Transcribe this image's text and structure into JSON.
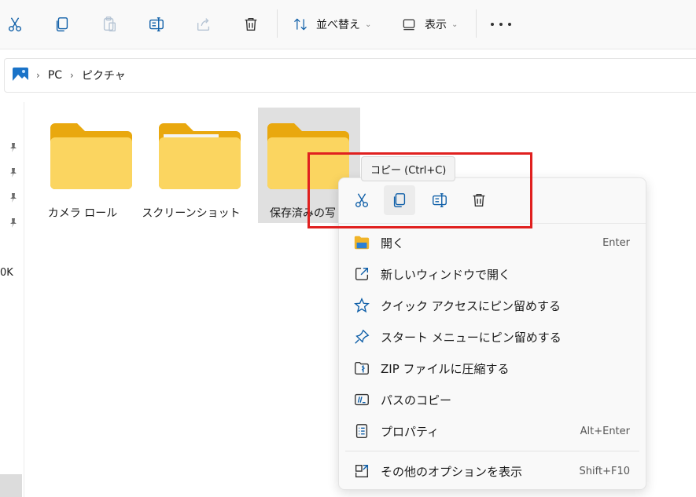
{
  "toolbar": {
    "sort_label": "並べ替え",
    "view_label": "表示"
  },
  "breadcrumb": [
    "PC",
    "ピクチャ"
  ],
  "sidebar": {
    "partial_text": "0K"
  },
  "folders": [
    {
      "name": "カメラ ロール"
    },
    {
      "name": "スクリーンショット"
    },
    {
      "name": "保存済みの写"
    }
  ],
  "tooltip": {
    "text": "コピー (Ctrl+C)"
  },
  "context_menu": {
    "items": [
      {
        "label": "開く",
        "shortcut": "Enter",
        "icon": "folder-open-icon"
      },
      {
        "label": "新しいウィンドウで開く",
        "shortcut": "",
        "icon": "open-new-window-icon"
      },
      {
        "label": "クイック アクセスにピン留めする",
        "shortcut": "",
        "icon": "star-icon"
      },
      {
        "label": "スタート メニューにピン留めする",
        "shortcut": "",
        "icon": "pin-icon"
      },
      {
        "label": "ZIP ファイルに圧縮する",
        "shortcut": "",
        "icon": "zip-icon"
      },
      {
        "label": "パスのコピー",
        "shortcut": "",
        "icon": "copy-path-icon"
      },
      {
        "label": "プロパティ",
        "shortcut": "Alt+Enter",
        "icon": "properties-icon"
      },
      {
        "label": "その他のオプションを表示",
        "shortcut": "Shift+F10",
        "icon": "more-options-icon"
      }
    ]
  },
  "colors": {
    "accent": "#0067c0",
    "folder": "#f7c948",
    "highlight": "#e0201f"
  }
}
